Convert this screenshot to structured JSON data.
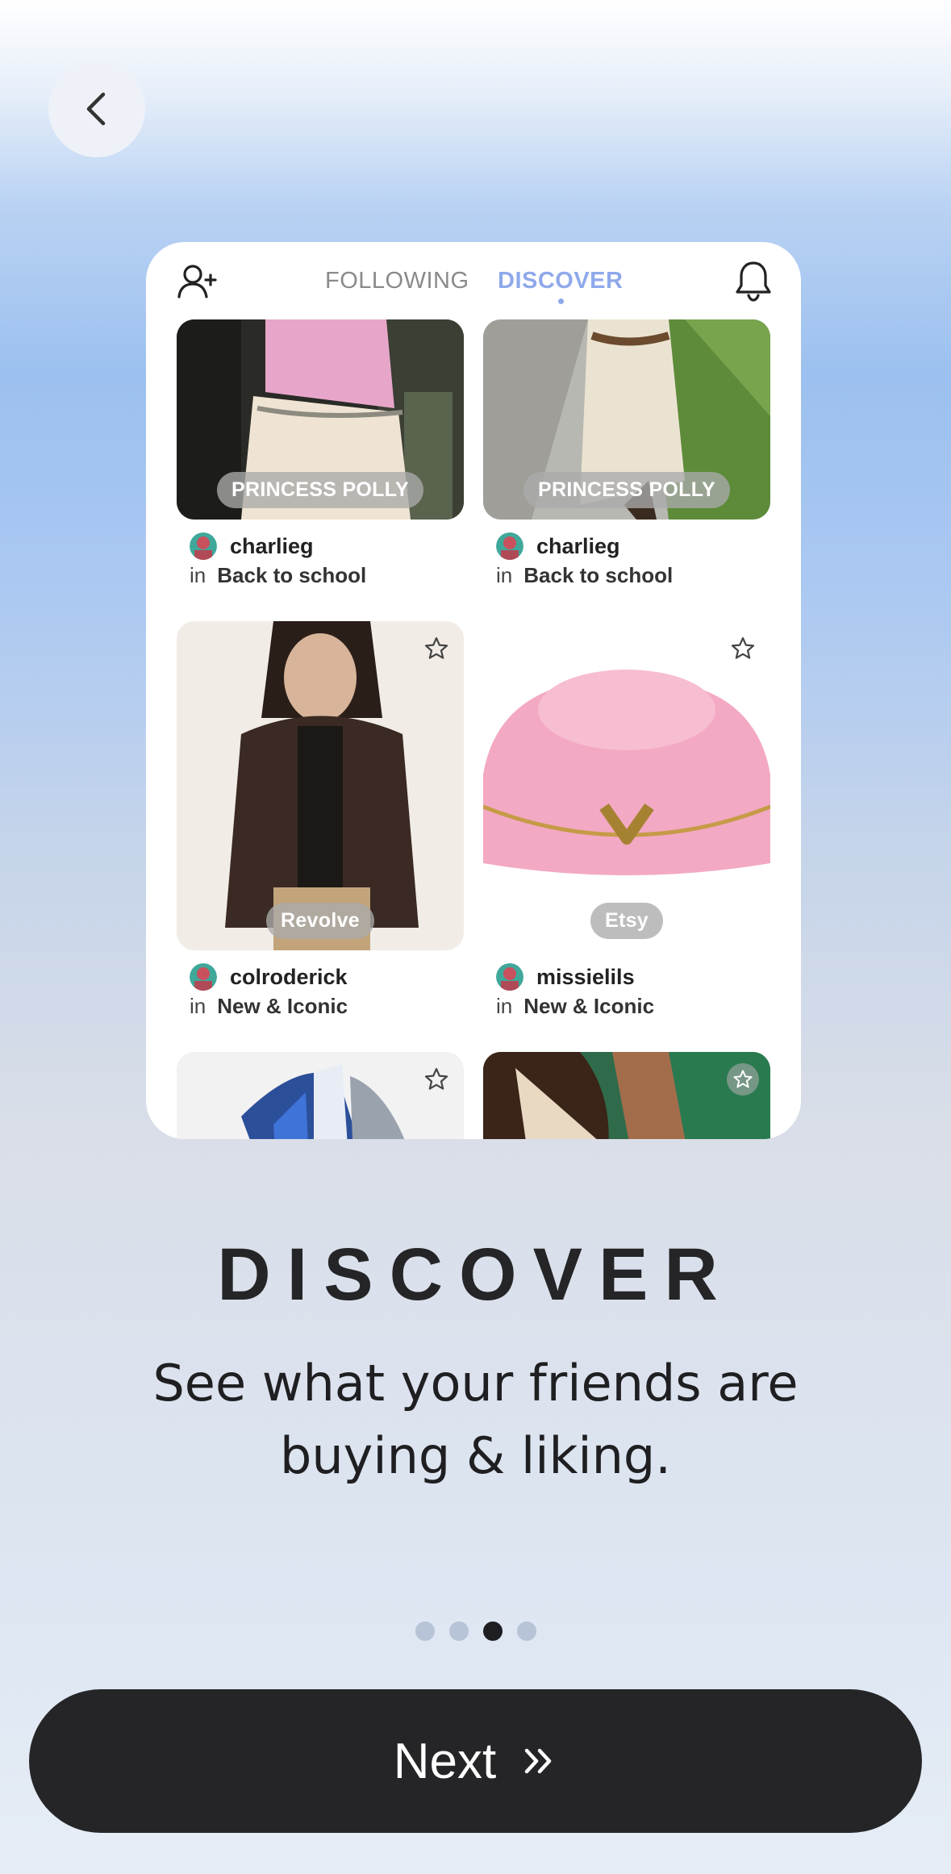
{
  "header": {
    "back_icon": "chevron-left-icon"
  },
  "preview": {
    "tabs": [
      {
        "label": "FOLLOWING"
      },
      {
        "label": "DISCOVER"
      }
    ],
    "icons": {
      "add_user": "add-user-icon",
      "notifications": "bell-icon",
      "favorite": "star-icon"
    },
    "posts": [
      {
        "brand": "PRINCESS POLLY",
        "username": "charlieg",
        "in_label": "in",
        "collection": "Back to school"
      },
      {
        "brand": "PRINCESS POLLY",
        "username": "charlieg",
        "in_label": "in",
        "collection": "Back to school"
      },
      {
        "brand": "Revolve",
        "username": "colroderick",
        "in_label": "in",
        "collection": "New & Iconic"
      },
      {
        "brand": "Etsy",
        "username": "missielils",
        "in_label": "in",
        "collection": "New & Iconic"
      }
    ]
  },
  "onboarding": {
    "title": "DISCOVER",
    "subtitle": "See what your friends are buying & liking.",
    "page_indicator": {
      "total": 4,
      "current": 3
    }
  },
  "next_button": {
    "label": "Next"
  }
}
